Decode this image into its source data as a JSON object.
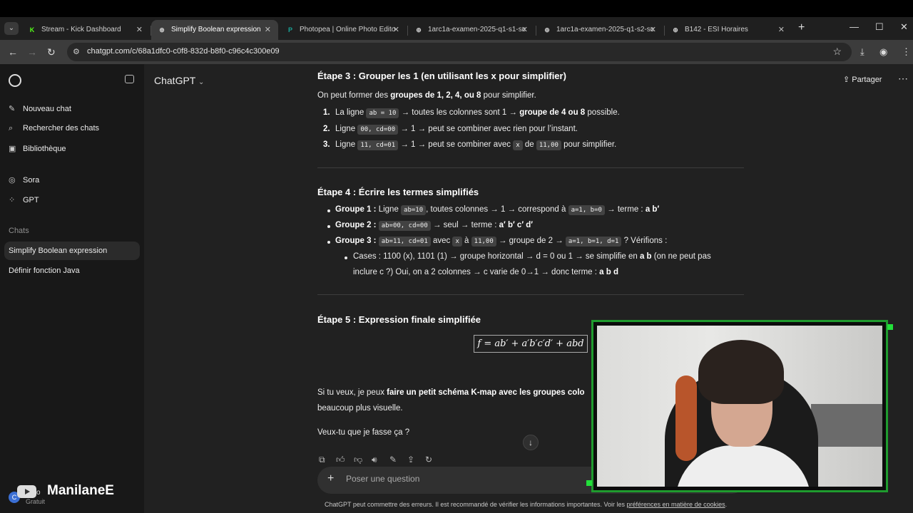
{
  "browser": {
    "tabs": [
      {
        "title": "Stream - Kick Dashboard",
        "favicon": "K",
        "color": "#53fc18"
      },
      {
        "title": "Simplify Boolean expression",
        "favicon": "⊛",
        "color": "#d0d0d0"
      },
      {
        "title": "Photopea | Online Photo Edito",
        "favicon": "P",
        "color": "#18a497"
      },
      {
        "title": "1arc1a-examen-2025-q1-s1-sc",
        "favicon": "⊕",
        "color": "#d0d0d0"
      },
      {
        "title": "1arc1a-examen-2025-q1-s2-sc",
        "favicon": "⊕",
        "color": "#d0d0d0"
      },
      {
        "title": "B142 - ESI Horaires",
        "favicon": "⊕",
        "color": "#d0d0d0"
      }
    ],
    "active_tab": 1,
    "url": "chatgpt.com/c/68a1dfc0-c0f8-832d-b8f0-c96c4c300e09"
  },
  "sidebar": {
    "items": [
      {
        "label": "Nouveau chat",
        "icon": "edit-icon",
        "glyph": "✎"
      },
      {
        "label": "Rechercher des chats",
        "icon": "search-icon",
        "glyph": "⌕"
      },
      {
        "label": "Bibliothèque",
        "icon": "library-icon",
        "glyph": "▣"
      }
    ],
    "apps": [
      {
        "label": "Sora",
        "icon": "sora-icon",
        "glyph": "◎"
      },
      {
        "label": "GPT",
        "icon": "gpt-grid-icon",
        "glyph": "⁘"
      }
    ],
    "chats_heading": "Chats",
    "chats": [
      {
        "label": "Simplify Boolean expression",
        "active": true
      },
      {
        "label": "Définir fonction Java",
        "active": false
      }
    ],
    "user": {
      "initial": "C",
      "name": "co",
      "plan": "Gratuit"
    }
  },
  "watermark": {
    "name": "ManilaneE"
  },
  "header": {
    "model": "ChatGPT",
    "share": "Partager"
  },
  "message": {
    "step3": {
      "title": "Étape 3 : Grouper les 1 (en utilisant les x pour simplifier)",
      "intro_pre": "On peut former des ",
      "intro_bold": "groupes de 1, 2, 4, ou 8",
      "intro_post": " pour simplifier.",
      "items": [
        {
          "num": "1.",
          "pre": "La ligne ",
          "code": "ab = 10",
          "mid": " → toutes les colonnes sont 1 → ",
          "bold": "groupe de 4 ou 8",
          "post": " possible."
        },
        {
          "num": "2.",
          "pre": "Ligne ",
          "code": "00, cd=00",
          "mid": " → 1 → peut se combiner avec rien pour l’instant."
        },
        {
          "num": "3.",
          "pre": "Ligne ",
          "code": "11, cd=01",
          "mid": " → 1 → peut se combiner avec ",
          "code2": "x",
          "mid2": " de ",
          "code3": "11,00",
          "post": " pour simplifier."
        }
      ]
    },
    "step4": {
      "title": "Étape 4 : Écrire les termes simplifiés",
      "g1": {
        "label": "Groupe 1 :",
        "pre": " Ligne ",
        "code": "ab=10",
        "mid": ", toutes colonnes → 1 → correspond à ",
        "code2": "a=1, b=0",
        "post": " → terme : ",
        "term": "a b′"
      },
      "g2": {
        "label": "Groupe 2 :",
        "code": "ab=00, cd=00",
        "post": " → seul → terme : ",
        "term": "a′ b′ c′ d′"
      },
      "g3": {
        "label": "Groupe 3 :",
        "code": "ab=11, cd=01",
        "mid": " avec ",
        "code2": "x",
        "mid2": " à ",
        "code3": "11,00",
        "mid3": " → groupe de 2 → ",
        "code4": "a=1, b=1, d=1",
        "post": " ? Vérifions :"
      },
      "sub_line1_pre": "Cases : 1100 (x), 1101 (1) → groupe horizontal → d = 0 ou 1 → se simplifie en ",
      "sub_line1_bold": "a b",
      "sub_line1_post": " (on ne peut pas",
      "sub_line2_pre": "inclure c ?) Oui, on a 2 colonnes → c varie de 0→1 → donc terme : ",
      "sub_line2_bold": "a b d"
    },
    "step5": {
      "title": "Étape 5 : Expression finale simplifiée",
      "formula": "f = ab′ + a′b′c′d′ + abd"
    },
    "offer_pre": "Si tu veux, je peux ",
    "offer_bold": "faire un petit schéma K-map avec les groupes colo",
    "offer_line2": "beaucoup plus visuelle.",
    "question": "Veux-tu que je fasse ça ?"
  },
  "composer": {
    "placeholder": "Poser une question"
  },
  "footer": {
    "disclaimer": "ChatGPT peut commettre des erreurs. Il est recommandé de vérifier les informations importantes. Voir les ",
    "link": "préférences en matière de cookies",
    "end": "."
  },
  "colors": {
    "background": "#212121",
    "sidebar": "#181818",
    "webcam_border": "#1f9b2e"
  }
}
